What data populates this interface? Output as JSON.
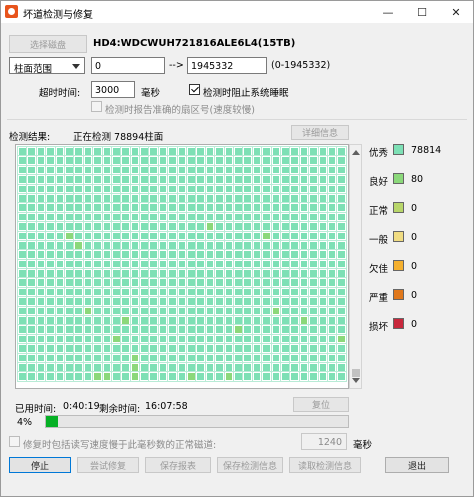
{
  "window": {
    "title": "坏道检测与修复",
    "controls": {
      "minimize": "—",
      "maximize": "☐",
      "close": "✕"
    }
  },
  "disk": {
    "select_button": "选择磁盘",
    "name": "HD4:WDCWUH721816ALE6L4(15TB)"
  },
  "range": {
    "mode": "柱面范围",
    "from": "0",
    "arrow": "-->",
    "to": "1945332",
    "hint": "(0-1945332)"
  },
  "timeout": {
    "label": "超时时间:",
    "value": "3000",
    "unit": "毫秒",
    "prevent_sleep_label": "检测时阻止系统睡眠",
    "prevent_sleep_checked": true,
    "report_sector_label": "检测时报告准确的扇区号(速度较慢)",
    "report_sector_checked": false
  },
  "results": {
    "label": "检测结果:",
    "status": "正在检测 78894柱面",
    "details_button": "详细信息"
  },
  "legend": [
    {
      "label": "优秀",
      "value": "78814",
      "color": "#7de0b5"
    },
    {
      "label": "良好",
      "value": "80",
      "color": "#8bd87a"
    },
    {
      "label": "正常",
      "value": "0",
      "color": "#b8d66a"
    },
    {
      "label": "一般",
      "value": "0",
      "color": "#f0dc82"
    },
    {
      "label": "欠佳",
      "value": "0",
      "color": "#f5b02e"
    },
    {
      "label": "严重",
      "value": "0",
      "color": "#e0781c"
    },
    {
      "label": "损坏",
      "value": "0",
      "color": "#c8283c"
    }
  ],
  "grid": {
    "columns": 35,
    "rows": 25,
    "good_cells": [
      300,
      320,
      341,
      356,
      602,
      622,
      641,
      660,
      688,
      710,
      734,
      782,
      817,
      848,
      849,
      852,
      858,
      862
    ]
  },
  "timing": {
    "elapsed_label": "已用时间:",
    "elapsed": "0:40:19",
    "remaining_label": "剩余时间:",
    "remaining": "16:07:58",
    "reset_button": "复位"
  },
  "progress": {
    "percent_label": "4%",
    "fraction": 0.04
  },
  "repair_option": {
    "label": "修复时包括读写速度慢于此毫秒数的正常磁道:",
    "value": "1240",
    "unit": "毫秒",
    "checked": false
  },
  "actions": {
    "stop": "停止",
    "try_repair": "尝试修复",
    "save_report": "保存报表",
    "save_state": "保存检测信息",
    "load_state": "读取检测信息",
    "exit": "退出"
  }
}
